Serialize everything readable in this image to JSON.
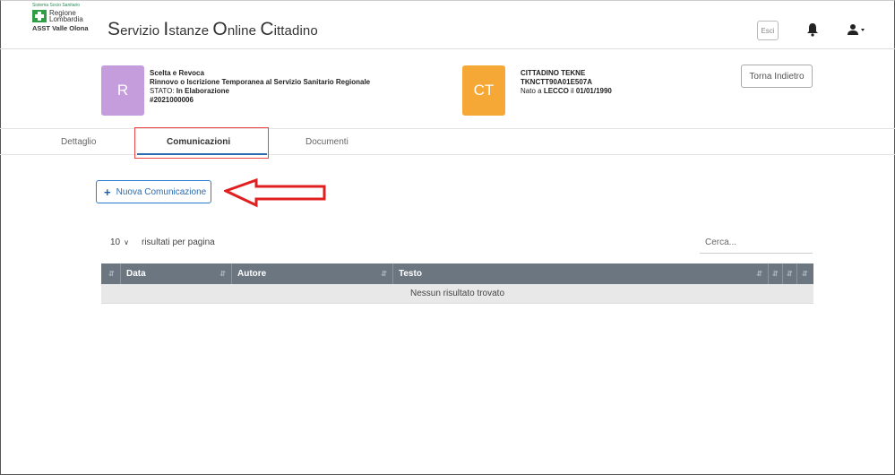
{
  "header": {
    "logo_system": "Sistema Socio Sanitario",
    "logo_region_line1": "Regione",
    "logo_region_line2": "Lombardia",
    "logo_asst": "ASST Valle Olona",
    "app_title": [
      {
        "cap": "S",
        "rest": "ervizio "
      },
      {
        "cap": "I",
        "rest": "stanze "
      },
      {
        "cap": "O",
        "rest": "nline "
      },
      {
        "cap": "C",
        "rest": "ittadino"
      }
    ],
    "logout_label": "Esci"
  },
  "request": {
    "avatar_letter": "R",
    "title": "Scelta e Revoca",
    "subtitle": "Rinnovo o Iscrizione Temporanea al Servizio Sanitario Regionale",
    "status_label": "STATO:",
    "status_value": "In Elaborazione",
    "number": "#2021000006"
  },
  "citizen": {
    "avatar_letters": "CT",
    "name": "CITTADINO TEKNE",
    "fiscal_code": "TKNCTT90A01E507A",
    "born_prefix": "Nato a",
    "born_place": "LECCO",
    "born_mid": "il",
    "born_date": "01/01/1990"
  },
  "back_button": "Torna Indietro",
  "tabs": {
    "details": "Dettaglio",
    "communications": "Comunicazioni",
    "documents": "Documenti"
  },
  "new_button": {
    "icon": "+",
    "label": "Nuova Comunicazione"
  },
  "table_controls": {
    "page_size": "10",
    "page_size_suffix": "risultati per pagina",
    "search_placeholder": "Cerca..."
  },
  "table": {
    "columns": [
      "Data",
      "Autore",
      "Testo"
    ],
    "empty_message": "Nessun risultato trovato"
  },
  "colors": {
    "request_avatar": "#c59ddd",
    "citizen_avatar": "#f5a836",
    "header_row": "#6b7681",
    "highlight": "#e44444"
  }
}
